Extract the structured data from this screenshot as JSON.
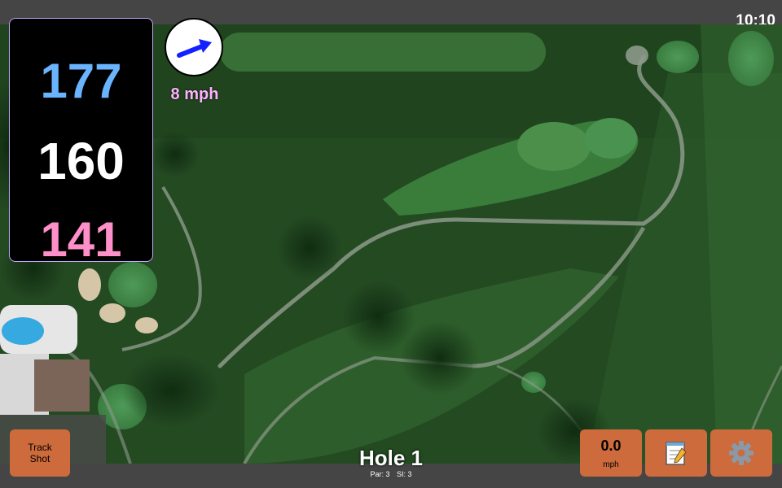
{
  "status": {
    "time": "10:10"
  },
  "yardages": {
    "back": "177",
    "middle": "160",
    "front": "141"
  },
  "wind": {
    "speed": "8 mph",
    "icon": "wind-arrow-icon",
    "color": "#1320ff"
  },
  "track_shot": {
    "label": "Track Shot"
  },
  "hole": {
    "title": "Hole 1",
    "par": "Par: 3",
    "si": "SI: 3"
  },
  "speed": {
    "value": "0.0",
    "unit": "mph"
  },
  "notes": {
    "icon": "notepad-icon"
  },
  "settings": {
    "icon": "gear-icon"
  },
  "colors": {
    "accent_button": "#cd6b3c",
    "back_yardage": "#6ab4ff",
    "front_yardage": "#ff8fc8",
    "wind_text": "#ffb2ff"
  }
}
